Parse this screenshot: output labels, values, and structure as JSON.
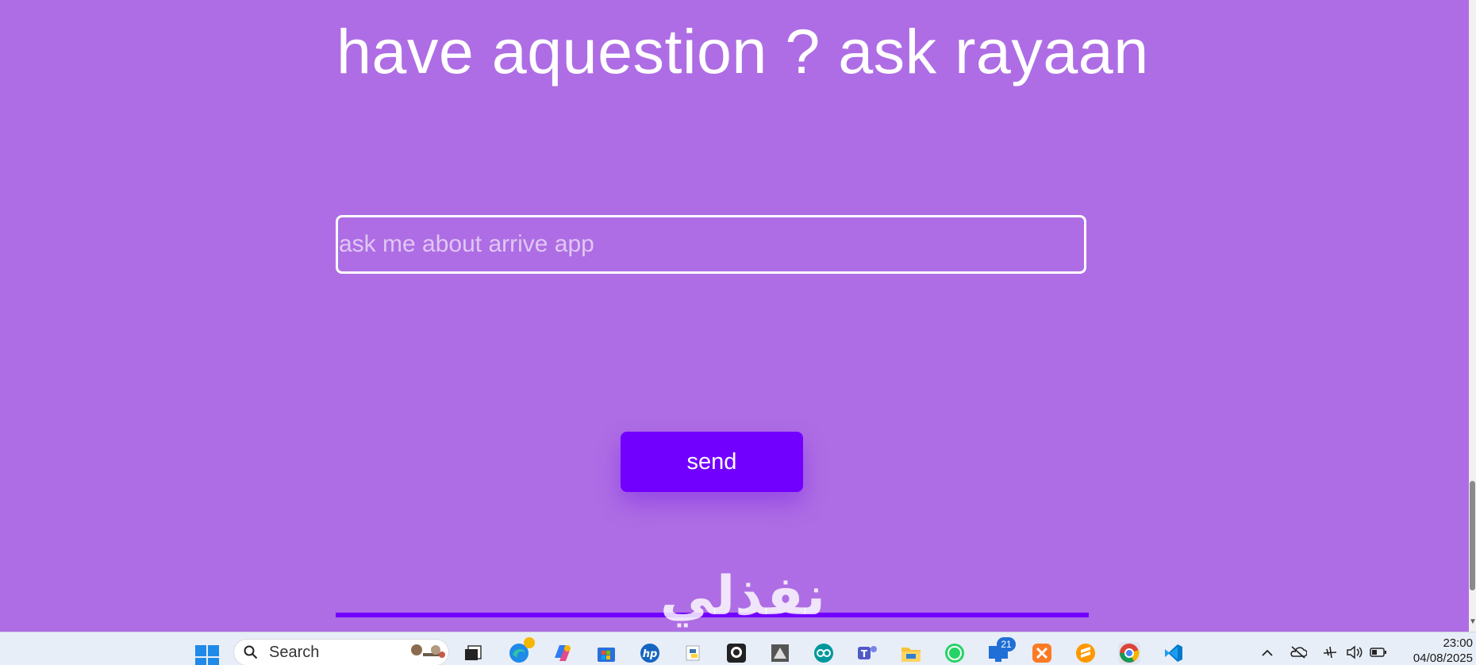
{
  "page": {
    "title": "have aquestion ? ask rayaan",
    "input_placeholder": "ask me about arrive app",
    "input_value": "",
    "send_label": "send",
    "watermark_text": "نفذلي"
  },
  "colors": {
    "background": "#ae6de4",
    "accent": "#7200ff",
    "taskbar": "#e8eef7"
  },
  "taskbar": {
    "search_label": "Search",
    "apps": [
      {
        "name": "start-icon"
      },
      {
        "name": "task-view-icon"
      },
      {
        "name": "edge-icon"
      },
      {
        "name": "copilot-icon"
      },
      {
        "name": "microsoft-store-icon"
      },
      {
        "name": "hp-icon"
      },
      {
        "name": "python-icon"
      },
      {
        "name": "github-icon"
      },
      {
        "name": "inkscape-icon"
      },
      {
        "name": "arduino-icon"
      },
      {
        "name": "teams-icon"
      },
      {
        "name": "file-explorer-icon"
      },
      {
        "name": "whatsapp-icon"
      },
      {
        "name": "remote-desktop-icon",
        "badge": "21"
      },
      {
        "name": "xampp-icon"
      },
      {
        "name": "sublime-text-icon"
      },
      {
        "name": "chrome-icon"
      },
      {
        "name": "vscode-icon"
      }
    ],
    "tray": {
      "time": "23:00",
      "date": "04/08/2025"
    }
  }
}
